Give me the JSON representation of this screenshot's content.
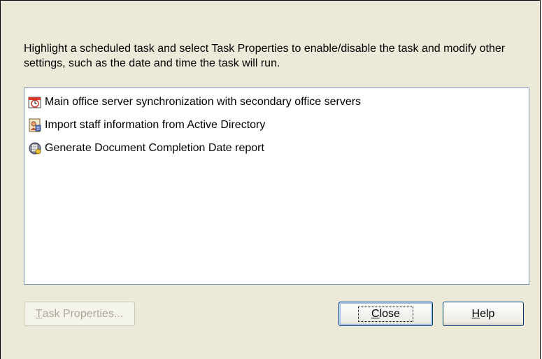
{
  "instructions": "Highlight a scheduled task and select Task Properties to enable/disable the task and modify other settings, such as the date and time the task will run.",
  "tasks": [
    {
      "icon": "clock-icon",
      "label": "Main office server synchronization with secondary office servers"
    },
    {
      "icon": "user-sync-icon",
      "label": "Import staff information from Active Directory"
    },
    {
      "icon": "report-icon",
      "label": "Generate Document Completion Date report"
    }
  ],
  "buttons": {
    "task_properties": {
      "mnemonic": "T",
      "rest": "ask Properties...",
      "enabled": false
    },
    "close": {
      "mnemonic": "C",
      "rest": "lose"
    },
    "help": {
      "mnemonic": "H",
      "rest": "elp"
    }
  }
}
